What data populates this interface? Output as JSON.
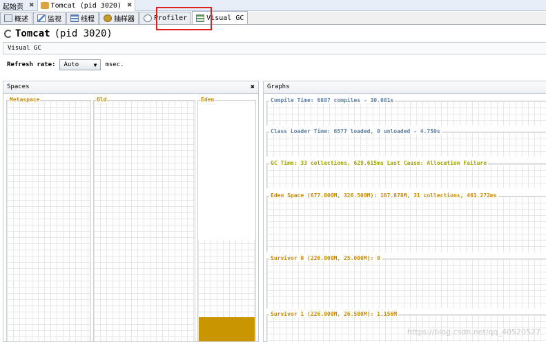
{
  "doc_tabs": [
    {
      "label": "起始页",
      "close": "✖"
    },
    {
      "label": "Tomcat (pid 3020)",
      "close": "✖"
    }
  ],
  "sub_tabs": [
    {
      "label": "概述",
      "icon": "overview-icon"
    },
    {
      "label": "监视",
      "icon": "monitor-icon"
    },
    {
      "label": "线程",
      "icon": "threads-icon"
    },
    {
      "label": "抽样器",
      "icon": "sampler-icon"
    },
    {
      "label": "Profiler",
      "icon": "profiler-icon"
    },
    {
      "label": "Visual GC",
      "icon": "visual-gc-icon"
    }
  ],
  "app": {
    "name": "Tomcat",
    "pid": "(pid 3020)"
  },
  "section_title": "Visual GC",
  "refresh": {
    "label": "Refresh rate:",
    "value": "Auto",
    "unit": "msec."
  },
  "spaces": {
    "title": "Spaces",
    "close": "✖",
    "metaspace": "Metaspace",
    "old": "Old",
    "eden": "Eden",
    "eden_fill_fraction": 0.215
  },
  "graphs": {
    "title": "Graphs",
    "items": [
      {
        "label": "Compile Time: 6887 compiles - 30.081s",
        "color": "#5b7ea5"
      },
      {
        "label": "Class Loader Time: 6577 loaded, 0 unloaded - 4.750s",
        "color": "#5b7ea5"
      },
      {
        "label": "GC Time: 33 collections, 629.615ms Last Cause: Allocation Failure",
        "color": "#9ea100"
      },
      {
        "label": "Eden Space (677.000M, 326.500M): 187.878M, 31 collections, 461.272ms",
        "color": "#c88a00"
      },
      {
        "label": "Survivor 0 (226.000M, 25.000M): 0",
        "color": "#c88a00"
      },
      {
        "label": "Survivor 1 (226.000M, 26.500M): 1.156M",
        "color": "#c88a00"
      }
    ]
  },
  "watermark": "https://blog.csdn.net/qq_40520527"
}
